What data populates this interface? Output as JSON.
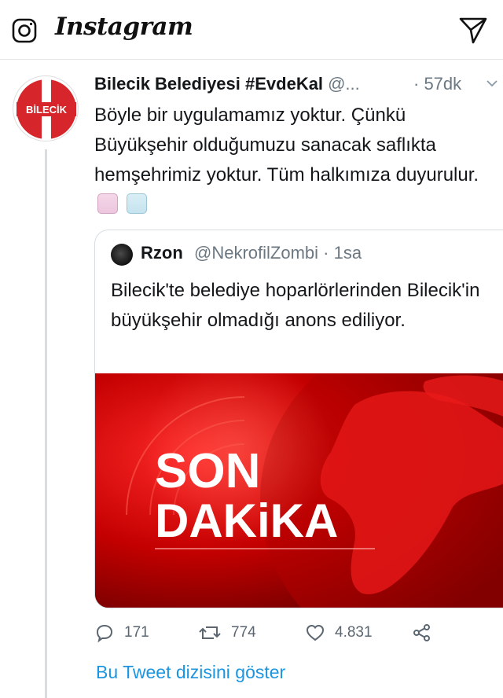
{
  "app": {
    "name": "Instagram",
    "icons": {
      "camera": "camera-icon",
      "send": "send-icon"
    }
  },
  "tweet": {
    "avatar_text": "BİLECİK",
    "name": "Bilecik Belediyesi #EvdeKal",
    "handle": "@...",
    "time": "· 57dk",
    "text": "Böyle bir uygulamamız yoktur. Çünkü Büyükşehir olduğumuzu sanacak saflıkta hemşehrimiz yoktur. Tüm halkımıza duyurulur.",
    "emojis": [
      "woman-facepalming-emoji",
      "man-facepalming-emoji"
    ],
    "quote": {
      "name": "Rzon",
      "handle": "@NekrofilZombi · 1sa",
      "text": "Bilecik'te belediye hoparlörlerinden Bilecik'in büyükşehir olmadığı anons ediliyor.",
      "media": {
        "line1": "SON",
        "line2": "DAKiKA"
      }
    },
    "actions": {
      "replies": "171",
      "retweets": "774",
      "likes": "4.831"
    },
    "show_thread": "Bu Tweet dizisini göster",
    "colors": {
      "link": "#1b95e0",
      "brand_red": "#d7262b"
    }
  }
}
